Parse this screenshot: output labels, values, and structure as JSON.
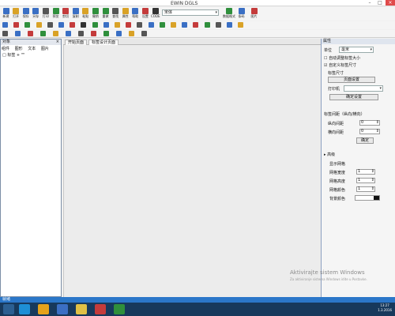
{
  "window": {
    "title": "EWIN DGLS",
    "controls": [
      "–",
      "□",
      "×"
    ]
  },
  "toolbar1": [
    {
      "label": "新建",
      "color": "#3a6fc4"
    },
    {
      "label": "打开",
      "color": "#d9a227"
    },
    {
      "label": "保存",
      "color": "#3a6fc4"
    },
    {
      "label": "另存",
      "color": "#3a6fc4"
    },
    {
      "label": "打印",
      "color": "#555555"
    },
    {
      "label": "预览",
      "color": "#2f8f3c"
    },
    {
      "label": "剪切",
      "color": "#c43b3b"
    },
    {
      "label": "复制",
      "color": "#3a6fc4"
    },
    {
      "label": "粘贴",
      "color": "#d9a227"
    },
    {
      "label": "撤销",
      "color": "#2f8f3c"
    },
    {
      "label": "重做",
      "color": "#2f8f3c"
    },
    {
      "label": "查找",
      "color": "#555555"
    },
    {
      "label": "属性",
      "color": "#d9a227"
    },
    {
      "label": "帮助",
      "color": "#3a6fc4"
    },
    {
      "label": "设置",
      "color": "#c43b3b"
    },
    {
      "label": "CODE",
      "color": "#333333"
    }
  ],
  "toolbar1_right": [
    {
      "label": "数据格式",
      "color": "#2f8f3c"
    },
    {
      "label": "条码",
      "color": "#3a6fc4"
    },
    {
      "label": "图片",
      "color": "#c43b3b"
    }
  ],
  "font_combo": {
    "value": "宋体"
  },
  "toolbar2_icons": [
    "#3a6fc4",
    "#c43b3b",
    "#2f8f3c",
    "#d9a227",
    "#555555",
    "#3a6fc4",
    "#c43b3b",
    "#333333",
    "#2f8f3c",
    "#3a6fc4",
    "#d9a227",
    "#c43b3b",
    "#555555",
    "#3a6fc4",
    "#2f8f3c",
    "#d9a227",
    "#3a6fc4",
    "#c43b3b",
    "#2f8f3c",
    "#555555",
    "#3a6fc4",
    "#d9a227"
  ],
  "toolbar3_icons": [
    "#555555",
    "#3a6fc4",
    "#c43b3b",
    "#2f8f3c",
    "#d9a227",
    "#3a6fc4",
    "#555555",
    "#c43b3b",
    "#2f8f3c",
    "#3a6fc4",
    "#d9a227",
    "#555555"
  ],
  "left_panel": {
    "title": "对象",
    "close": "×",
    "tabs": [
      "组件",
      "图形",
      "文本",
      "图片"
    ],
    "tree_item": "□ 标签 + \"\""
  },
  "doc_tabs": [
    "开始页面",
    "标签设计页面"
  ],
  "right_panel": {
    "header": "属性",
    "unit_label": "单位",
    "unit_value": "毫米",
    "cb1": "☐ 自动调整标签大小",
    "cb2": "☑ 自定义标签尺寸",
    "group1_label": "标签尺寸",
    "btn_page": "页面设置",
    "printer_label": "打印机",
    "btn_apply": "确定设置",
    "group2_label": "标签间距（纵向/横向）",
    "row1_label": "纵向间距",
    "row1_value": "0",
    "row2_label": "横向间距",
    "row2_value": "0",
    "btn_ok": "确定",
    "group3_label": "▸ 高级",
    "opt_label": "显示网格",
    "p1_label": "网格宽度",
    "p2_label": "网格高度",
    "p3_label": "网格颜色",
    "p4_label": "背景颜色",
    "p1_value": "1",
    "p2_value": "1",
    "p3_value": "1",
    "bg_color": "#111111"
  },
  "watermark": {
    "line1": "Aktivirajte sistem Windows",
    "line2": "Za aktiviranje sistema Windows idite u Postavke."
  },
  "status": {
    "text": "就绪"
  },
  "tray": {
    "time": "13:27",
    "date": "1.3.2016"
  },
  "taskbar_apps": [
    "#1e8fd6",
    "#e5a21b",
    "#3b6fc4",
    "#e0c045",
    "#c43b3b",
    "#2f8f3c"
  ]
}
